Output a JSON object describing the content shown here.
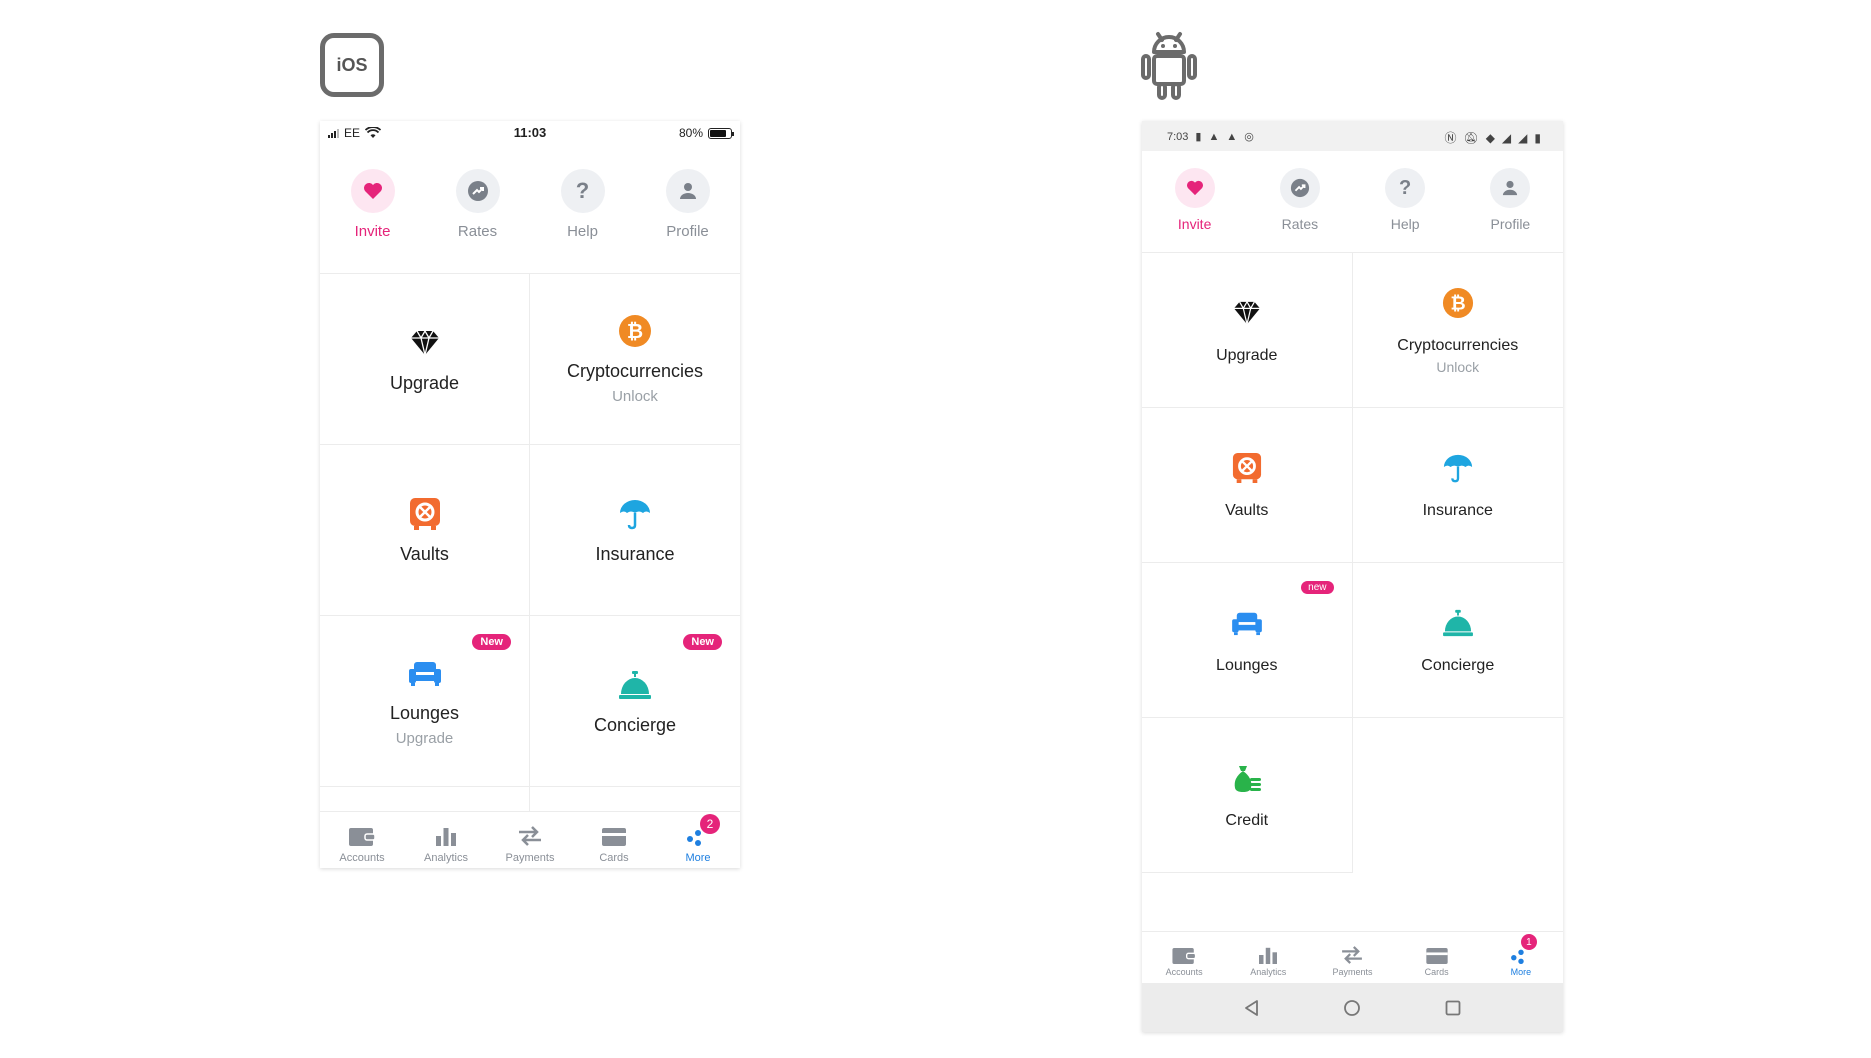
{
  "platforms": {
    "ios_label": "iOS"
  },
  "ios": {
    "status": {
      "carrier": "EE",
      "time": "11:03",
      "battery": "80%"
    },
    "quick": [
      {
        "label": "Invite"
      },
      {
        "label": "Rates"
      },
      {
        "label": "Help"
      },
      {
        "label": "Profile"
      }
    ],
    "grid": [
      {
        "title": "Upgrade",
        "sub": ""
      },
      {
        "title": "Cryptocurrencies",
        "sub": "Unlock"
      },
      {
        "title": "Vaults",
        "sub": ""
      },
      {
        "title": "Insurance",
        "sub": ""
      },
      {
        "title": "Lounges",
        "sub": "Upgrade",
        "badge": "New"
      },
      {
        "title": "Concierge",
        "sub": "",
        "badge": "New"
      }
    ],
    "nav": [
      {
        "label": "Accounts"
      },
      {
        "label": "Analytics"
      },
      {
        "label": "Payments"
      },
      {
        "label": "Cards"
      },
      {
        "label": "More",
        "count": "2"
      }
    ]
  },
  "android": {
    "status": {
      "time": "7:03"
    },
    "quick": [
      {
        "label": "Invite"
      },
      {
        "label": "Rates"
      },
      {
        "label": "Help"
      },
      {
        "label": "Profile"
      }
    ],
    "grid": [
      {
        "title": "Upgrade",
        "sub": ""
      },
      {
        "title": "Cryptocurrencies",
        "sub": "Unlock"
      },
      {
        "title": "Vaults",
        "sub": ""
      },
      {
        "title": "Insurance",
        "sub": ""
      },
      {
        "title": "Lounges",
        "sub": "",
        "badge": "new"
      },
      {
        "title": "Concierge",
        "sub": ""
      },
      {
        "title": "Credit",
        "sub": ""
      }
    ],
    "nav": [
      {
        "label": "Accounts"
      },
      {
        "label": "Analytics"
      },
      {
        "label": "Payments"
      },
      {
        "label": "Cards"
      },
      {
        "label": "More",
        "count": "1"
      }
    ]
  },
  "colors": {
    "accent_pink": "#e5247a",
    "accent_blue": "#1e7fe0",
    "bitcoin_orange": "#f08a24",
    "vault_orange": "#f26b2f",
    "insurance_cyan": "#1ea5e0",
    "lounge_blue": "#2b8ef0",
    "concierge_teal": "#1fb5a8",
    "credit_green": "#29b34a"
  }
}
